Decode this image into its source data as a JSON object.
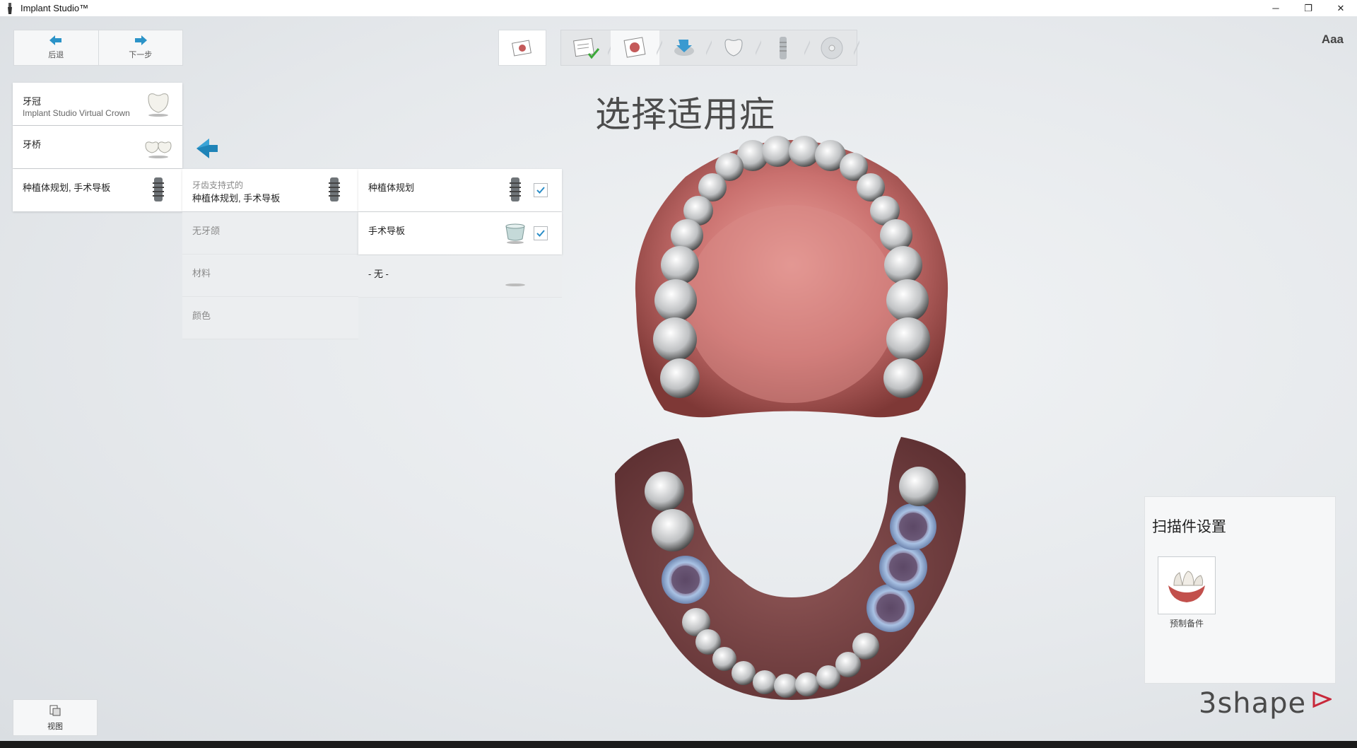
{
  "window": {
    "title": "Implant Studio™",
    "min": "─",
    "restore": "❐",
    "close": "✕"
  },
  "nav": {
    "back_label": "后退",
    "next_label": "下一步"
  },
  "font_size_control": "Aaa",
  "page_title": "选择适用症",
  "indication_types": [
    {
      "label": "牙冠",
      "sub": "Implant Studio Virtual Crown",
      "icon": "crown-icon",
      "selected": true
    },
    {
      "label": "牙桥",
      "sub": "",
      "icon": "bridge-icon",
      "selected": true
    },
    {
      "label": "种植体规划, 手术导板",
      "sub": "",
      "icon": "implant-icon",
      "selected": true
    }
  ],
  "sub_categories": [
    {
      "top": "牙齿支持式的",
      "label": "种植体规划, 手术导板",
      "selected": true
    },
    {
      "top": "",
      "label": "无牙颌",
      "selected": false
    },
    {
      "top": "",
      "label": "材料",
      "selected": false
    },
    {
      "top": "",
      "label": "颜色",
      "selected": false
    }
  ],
  "options": [
    {
      "label": "种植体规划",
      "checked": true,
      "icon": "implant-icon"
    },
    {
      "label": "手术导板",
      "checked": true,
      "icon": "guide-icon"
    },
    {
      "label": "- 无 -",
      "checked": false,
      "icon": ""
    }
  ],
  "scan_panel": {
    "title": "扫描件设置",
    "item_label": "预制备件"
  },
  "logo_text": "3shape",
  "view_button": "视图",
  "colors": {
    "accent": "#1e8fc4",
    "gum": "#c9706e",
    "check": "#2a8dc7"
  }
}
